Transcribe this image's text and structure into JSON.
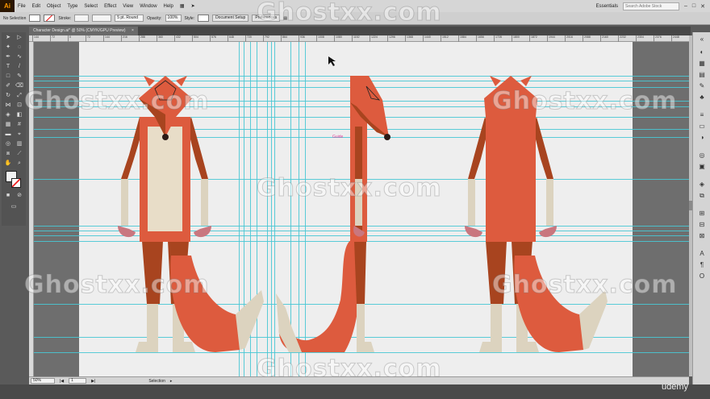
{
  "app": {
    "logo": "Ai"
  },
  "menu": [
    "File",
    "Edit",
    "Object",
    "Type",
    "Select",
    "Effect",
    "View",
    "Window",
    "Help"
  ],
  "menu_right": {
    "workspace": "Essentials",
    "search_placeholder": "Search Adobe Stock"
  },
  "control": {
    "selection_label": "No Selection",
    "stroke_label": "Stroke:",
    "brush": "5 pt. Round",
    "opacity_label": "Opacity:",
    "opacity_value": "100%",
    "style_label": "Style:",
    "doc_setup": "Document Setup",
    "preferences": "Preferences"
  },
  "tab": {
    "title": "Character Design.ai* @ 50% (CMYK/GPU Preview)",
    "close": "×"
  },
  "canvas": {
    "guide_label": "Guide"
  },
  "status": {
    "zoom": "50%",
    "artboard": "1",
    "tool": "Selection"
  },
  "watermark": "Ghostxx.com",
  "brand": "udemy",
  "ruler_labels": [
    "144",
    "72",
    "0",
    "72",
    "144",
    "216",
    "288",
    "360",
    "432",
    "504",
    "576",
    "648",
    "720",
    "792",
    "864",
    "936",
    "1008",
    "1080",
    "1152",
    "1224",
    "1296",
    "1368",
    "1440",
    "1512",
    "1584",
    "1656",
    "1728",
    "1800",
    "1872",
    "1944",
    "2016",
    "2088",
    "2160",
    "2232",
    "2304",
    "2376",
    "2448"
  ],
  "colors": {
    "fox_orange": "#dd5b3e",
    "fox_brown": "#a8441f",
    "cream": "#e8ddc8",
    "bone": "#dcd3bf",
    "guide": "#48c7d4"
  }
}
